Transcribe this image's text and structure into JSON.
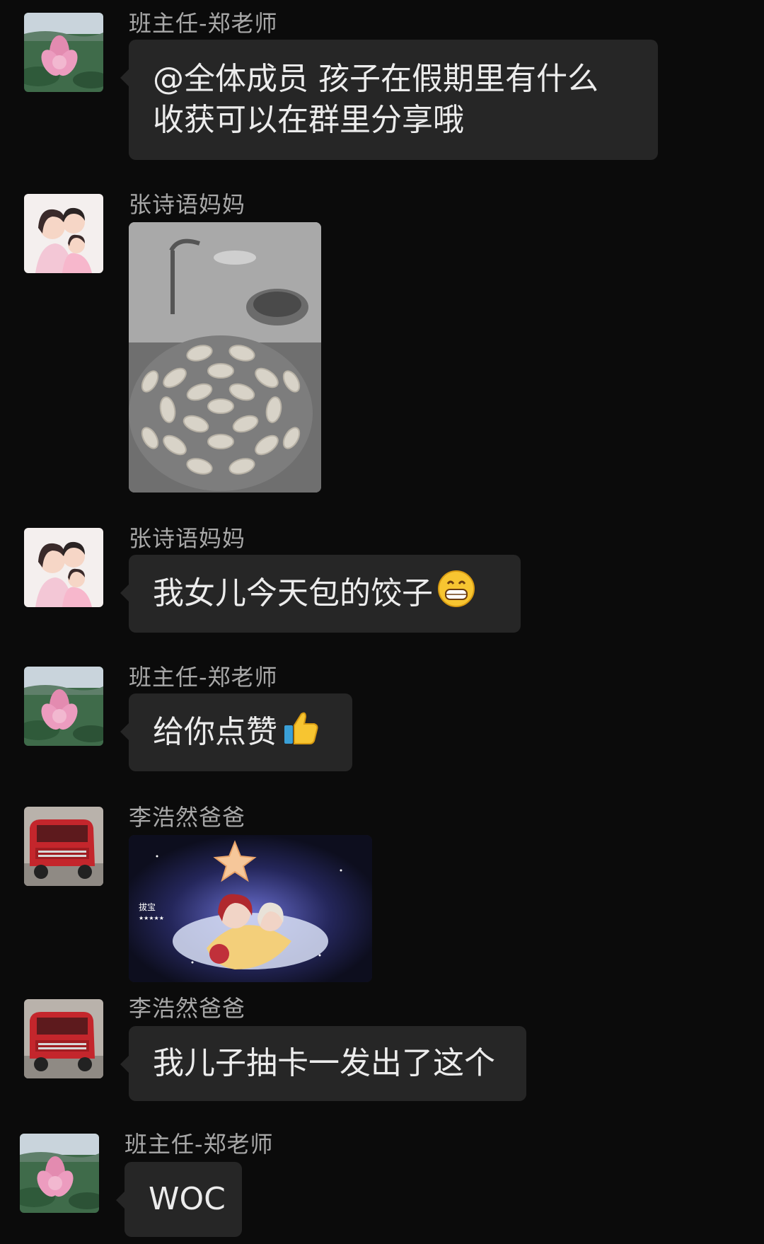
{
  "messages": [
    {
      "sender": "班主任-郑老师",
      "avatar": "lotus-flower-avatar",
      "type": "text",
      "text": "@全体成员 孩子在假期里有什么\n收获可以在群里分享哦"
    },
    {
      "sender": "张诗语妈妈",
      "avatar": "family-cartoon-avatar",
      "type": "image",
      "image": "dumplings-tray-photo"
    },
    {
      "sender": "张诗语妈妈",
      "avatar": "family-cartoon-avatar",
      "type": "text",
      "text": "我女儿今天包的饺子",
      "emoji": "grinning-face-emoji"
    },
    {
      "sender": "班主任-郑老师",
      "avatar": "lotus-flower-avatar",
      "type": "text",
      "text": "给你点赞",
      "emoji": "thumbs-up-emoji"
    },
    {
      "sender": "李浩然爸爸",
      "avatar": "red-truck-avatar",
      "type": "image",
      "image": "anime-gacha-card-image"
    },
    {
      "sender": "李浩然爸爸",
      "avatar": "red-truck-avatar",
      "type": "text",
      "text": "我儿子抽卡一发出了这个"
    },
    {
      "sender": "班主任-郑老师",
      "avatar": "lotus-flower-avatar",
      "type": "text",
      "text": "WOC"
    }
  ],
  "colors": {
    "background": "#0b0b0b",
    "bubble": "#262626",
    "sender_text": "#a8a8a8",
    "message_text": "#ececec"
  }
}
